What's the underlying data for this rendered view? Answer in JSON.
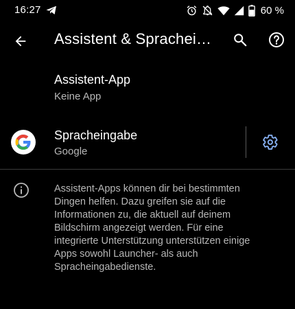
{
  "status_bar": {
    "time": "16:27",
    "battery_percent": "60 %",
    "icons": [
      "telegram-icon",
      "alarm-icon",
      "notifications-off-icon",
      "wifi-icon",
      "cellular-signal-icon",
      "battery-icon"
    ]
  },
  "app_bar": {
    "title": "Assistent & Sprachei…",
    "back_icon": "arrow-back-icon",
    "search_icon": "search-icon",
    "help_icon": "help-icon"
  },
  "assistant_app": {
    "title": "Assistent-App",
    "summary": "Keine App"
  },
  "voice_input": {
    "title": "Spracheingabe",
    "summary": "Google",
    "logo": "google-logo",
    "settings_icon": "gear-icon"
  },
  "info": {
    "icon": "info-icon",
    "text": "Assistent-Apps können dir bei bestimmten Dingen helfen. Dazu greifen sie auf die Informationen zu, die aktuell auf deinem Bildschirm angezeigt werden. Für eine integrierte Unterstützung unterstützen einige Apps sowohl Launcher- als auch Spracheingabedienste."
  },
  "colors": {
    "background": "#000000",
    "primary_text": "#ffffff",
    "secondary_text": "#b8b8b8",
    "accent": "#8ab4f8",
    "divider": "#3c3c3c"
  }
}
